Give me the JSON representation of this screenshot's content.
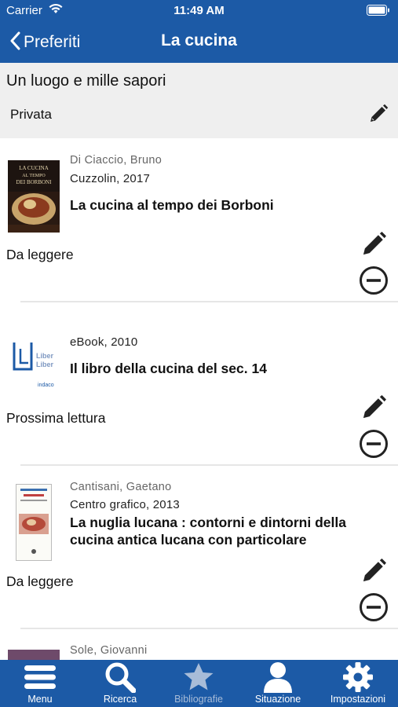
{
  "status_bar": {
    "carrier": "Carrier",
    "time": "11:49 AM"
  },
  "nav": {
    "back_label": "Preferiti",
    "title": "La cucina"
  },
  "list_info": {
    "name": "Un luogo e mille sapori",
    "privacy": "Privata"
  },
  "entries": [
    {
      "author": "Di Ciaccio, Bruno",
      "publisher": "Cuzzolin, 2017",
      "title": "La cucina al tempo dei Borboni",
      "status": "Da leggere",
      "cover_text": "LA CUCINA AL TEMPO DEI BORBONI"
    },
    {
      "author": "",
      "publisher": "eBook, 2010",
      "title": "Il libro della cucina del sec. 14",
      "status": "Prossima lettura",
      "cover_text": "Liber Liber"
    },
    {
      "author": "Cantisani, Gaetano",
      "publisher": "Centro grafico, 2013",
      "title": "La nuglia lucana : contorni e dintorni della cucina antica lucana con particolare",
      "status": "Da leggere",
      "cover_text": ""
    },
    {
      "author": "Sole, Giovanni",
      "publisher": "",
      "title": "",
      "status": "",
      "cover_text": ""
    }
  ],
  "tabs": [
    {
      "label": "Menu",
      "icon": "menu-icon",
      "active": true
    },
    {
      "label": "Ricerca",
      "icon": "search-icon",
      "active": true
    },
    {
      "label": "Bibliografie",
      "icon": "star-icon",
      "active": false
    },
    {
      "label": "Situazione",
      "icon": "person-icon",
      "active": true
    },
    {
      "label": "Impostazioni",
      "icon": "gear-icon",
      "active": true
    }
  ],
  "colors": {
    "accent": "#1c5aa6",
    "info_background": "#efefef",
    "divider": "#e6e6e6"
  }
}
